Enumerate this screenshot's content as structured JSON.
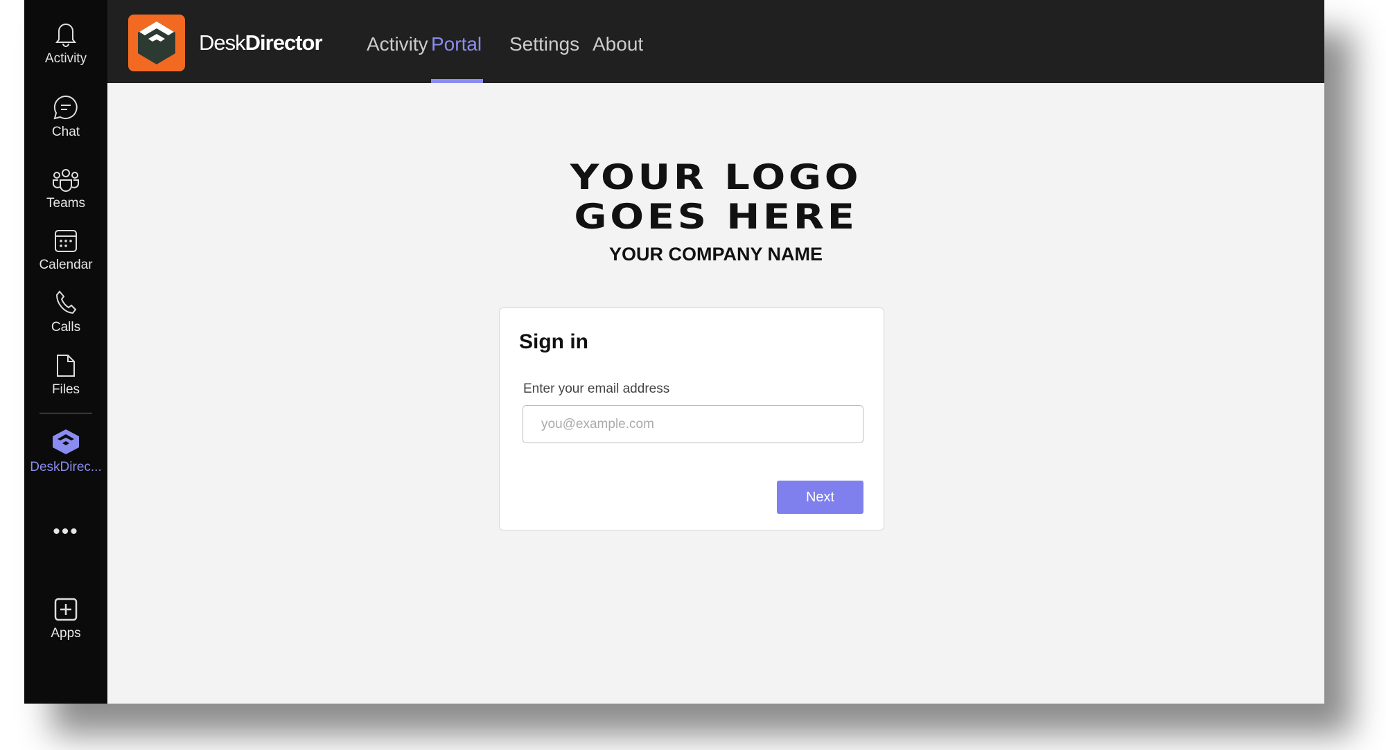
{
  "rail": {
    "items": [
      {
        "label": "Activity",
        "icon": "bell-icon"
      },
      {
        "label": "Chat",
        "icon": "chat-icon"
      },
      {
        "label": "Teams",
        "icon": "teams-icon"
      },
      {
        "label": "Calendar",
        "icon": "calendar-icon"
      },
      {
        "label": "Calls",
        "icon": "phone-icon"
      },
      {
        "label": "Files",
        "icon": "file-icon"
      },
      {
        "label": "DeskDirec...",
        "icon": "deskdirector-icon"
      },
      {
        "label": "Apps",
        "icon": "plus-square-icon"
      }
    ],
    "more": "more-icon"
  },
  "header": {
    "brand_light": "Desk",
    "brand_bold": "Director",
    "tabs": [
      "Activity",
      "Portal",
      "Settings",
      "About"
    ],
    "selected": "Portal"
  },
  "main": {
    "logo_line1": "YOUR LOGO",
    "logo_line2": "GOES HERE",
    "company": "YOUR COMPANY NAME",
    "signin": {
      "title": "Sign in",
      "label": "Enter your email address",
      "placeholder": "you@example.com",
      "value": "",
      "next": "Next"
    }
  },
  "colors": {
    "accent": "#8b8cf0",
    "brand": "#f26a21",
    "button": "#7f80ee"
  }
}
